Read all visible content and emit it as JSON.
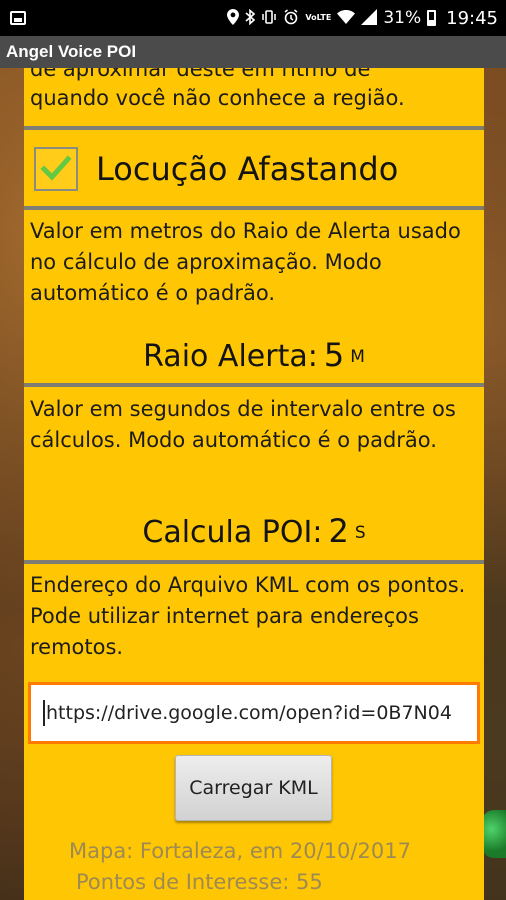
{
  "status_bar": {
    "battery": "31%",
    "time": "19:45",
    "icons": [
      "gallery-icon",
      "location-icon",
      "bluetooth-icon",
      "vibrate-icon",
      "alarm-icon",
      "volte-icon",
      "wifi-icon",
      "signal-icon",
      "battery-icon"
    ],
    "volte": "VoLTE"
  },
  "app": {
    "title": "Angel Voice POI"
  },
  "settings": {
    "region_text": "quando você não conhece a região.",
    "cut_text": "de aproximar deste em ritmo de",
    "locucao_afastando": {
      "label": "Locução Afastando",
      "checked": true
    },
    "raio": {
      "description": "Valor em metros do Raio de Alerta usado no cálculo de aproximação. Modo automático é o padrão.",
      "label": "Raio Alerta:",
      "value": "5",
      "unit": "M"
    },
    "calcula": {
      "description": "Valor em segundos de intervalo entre os cálculos. Modo automático é o padrão.",
      "label": "Calcula POI:",
      "value": "2",
      "unit": "S"
    },
    "kml": {
      "description": "Endereço do  Arquivo KML com os pontos. Pode utilizar internet para endereços remotos.",
      "url": "https://drive.google.com/open?id=0B7N04",
      "button_label": "Carregar KML"
    },
    "map_info": "Mapa: Fortaleza, em 20/10/2017",
    "poi_count": "Pontos de Interesse: 55"
  },
  "colors": {
    "panel": "#ffc603",
    "title_bar": "#4b4b4b",
    "divider": "#7d7d74",
    "input_border": "#ff7a00",
    "check": "#63c842"
  }
}
